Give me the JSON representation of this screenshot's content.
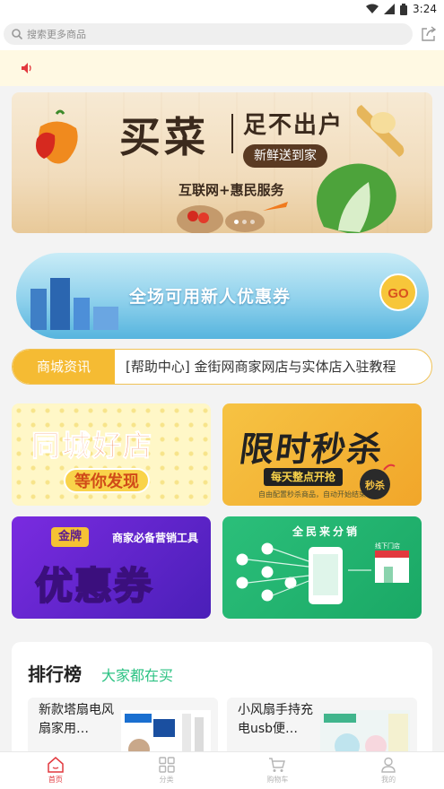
{
  "status_bar": {
    "time": "3:24",
    "icons": [
      "wifi-icon",
      "signal-icon",
      "battery-icon"
    ]
  },
  "search": {
    "placeholder": "搜索更多商品",
    "icons": [
      "search-icon",
      "share-icon"
    ]
  },
  "notice": {
    "icon": "speaker-icon"
  },
  "main_banner": {
    "title": "买菜",
    "tagline": "足不出户",
    "pill": "新鲜送到家",
    "subtitle": "互联网+惠民服务"
  },
  "coupon_banner": {
    "text": "全场可用新人优惠券",
    "badge": "GO"
  },
  "news_ticker": {
    "label": "商城资讯",
    "text": "[帮助中心] 金街网商家网店与实体店入驻教程"
  },
  "promo_tiles": {
    "shop": {
      "title": "同城好店",
      "subtitle": "等你发现"
    },
    "flash": {
      "title": "限时秒杀",
      "badge": "每天整点开抢",
      "note": "自由配置秒杀商品，自动开始结束",
      "bomb_label": "秒杀"
    },
    "coupon": {
      "tag": "金牌",
      "tagline": "商家必备营销工具",
      "title": "优惠券"
    },
    "distribution": {
      "title": "全民来分销",
      "shop_sign": "线下门店"
    }
  },
  "ranking": {
    "title": "排行榜",
    "subtitle": "大家都在买",
    "items": [
      {
        "name": "新款塔扇电风扇家用…"
      },
      {
        "name": "小风扇手持充电usb便…"
      }
    ]
  },
  "bottom_nav": {
    "items": [
      {
        "label": "首页",
        "icon": "home-icon",
        "active": true
      },
      {
        "label": "分类",
        "icon": "category-icon",
        "active": false
      },
      {
        "label": "购物车",
        "icon": "cart-icon",
        "active": false
      },
      {
        "label": "我的",
        "icon": "user-icon",
        "active": false
      }
    ]
  },
  "colors": {
    "accent": "#e2383e",
    "ticker": "#f5bb33",
    "ranking_sub": "#2cc283",
    "notice_bg": "#fff9e3"
  }
}
